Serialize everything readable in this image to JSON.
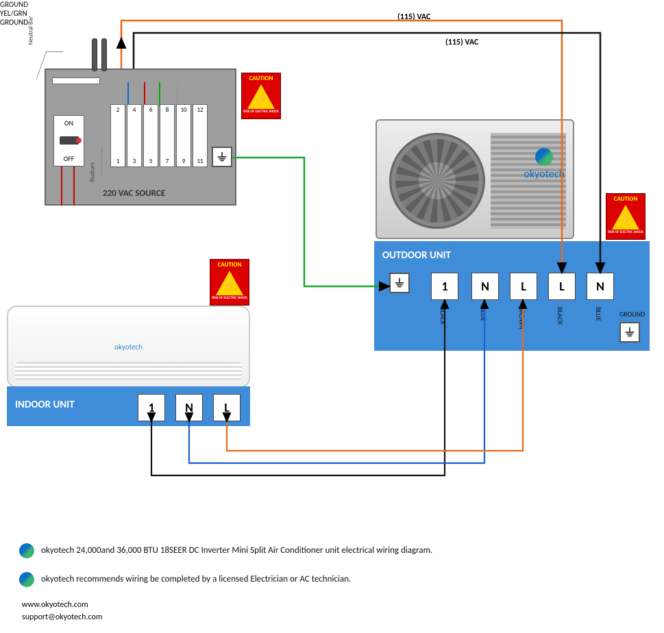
{
  "voltage_labels": {
    "top1": "(115) VAC",
    "top2": "(115) VAC"
  },
  "panel": {
    "source_label": "220 VAC SOURCE",
    "neutral_label": "Neutral\nBar",
    "busbars_label": "Busbars",
    "main_on": "ON",
    "main_off": "OFF",
    "breaker_numbers_top": [
      "2",
      "4",
      "6",
      "8",
      "10",
      "12"
    ],
    "breaker_numbers_bot": [
      "1",
      "3",
      "5",
      "7",
      "9",
      "11"
    ]
  },
  "ground": {
    "text": "GROUND",
    "yel_grn": "YEL/GRN",
    "ground2": "GROUND"
  },
  "caution": {
    "title": "CAUTION",
    "sub": "RISK OF ELECTRIC SHOCK"
  },
  "outdoor": {
    "title": "OUTDOOR UNIT",
    "terminals": {
      "t1": "1",
      "tN1": "N",
      "tL1": "L",
      "tL2": "L",
      "tN2": "N"
    },
    "wire_colors": {
      "t1": "BLACK",
      "tN1": "BLUE",
      "tL1": "BROWN",
      "tL2": "BLACK",
      "tN2": "BLUE"
    },
    "ground_label": "GROUND",
    "brand": "okyotech"
  },
  "indoor": {
    "title": "INDOOR UNIT",
    "terminals": {
      "t1": "1",
      "tN": "N",
      "tL": "L"
    },
    "brand": "okyotech"
  },
  "notes": {
    "line1": "okyotech 24,000and 36,000 BTU 18SEER DC Inverter Mini Split Air Conditioner unit electrical wiring diagram.",
    "line2": "okyotech recommends wiring be completed by a licensed Electrician or AC technician."
  },
  "contact": {
    "site": "www.okyotech.com",
    "email": "support@okyotech.com"
  },
  "colors": {
    "orange": "#e86a17",
    "black": "#111111",
    "green": "#18a82b",
    "blue": "#1860d0",
    "brown": "#e86a17",
    "panel_blue": "#3f8cd9"
  }
}
